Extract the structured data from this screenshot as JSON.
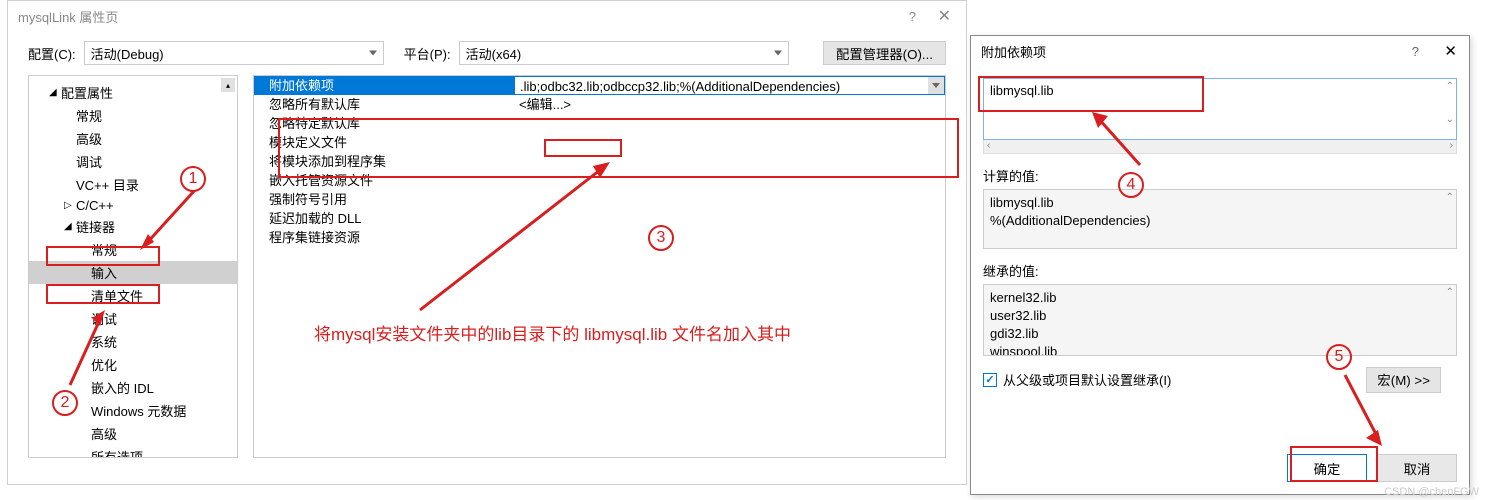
{
  "main": {
    "title": "mysqlLink 属性页",
    "help": "?",
    "close": "✕",
    "config_label": "配置(C):",
    "config_value": "活动(Debug)",
    "platform_label": "平台(P):",
    "platform_value": "活动(x64)",
    "config_mgr": "配置管理器(O)...",
    "tree": [
      {
        "label": "配置属性",
        "level": 0,
        "arrow": "◢"
      },
      {
        "label": "常规",
        "level": 1
      },
      {
        "label": "高级",
        "level": 1
      },
      {
        "label": "调试",
        "level": 1
      },
      {
        "label": "VC++ 目录",
        "level": 1
      },
      {
        "label": "C/C++",
        "level": 1,
        "arrow": "▷"
      },
      {
        "label": "链接器",
        "level": 1,
        "arrow": "◢"
      },
      {
        "label": "常规",
        "level": 2
      },
      {
        "label": "输入",
        "level": 2,
        "selected": true
      },
      {
        "label": "清单文件",
        "level": 2
      },
      {
        "label": "调试",
        "level": 2
      },
      {
        "label": "系统",
        "level": 2
      },
      {
        "label": "优化",
        "level": 2
      },
      {
        "label": "嵌入的 IDL",
        "level": 2
      },
      {
        "label": "Windows 元数据",
        "level": 2
      },
      {
        "label": "高级",
        "level": 2
      },
      {
        "label": "所有选项",
        "level": 2
      }
    ],
    "grid": [
      {
        "label": "附加依赖项",
        "value": ".lib;odbc32.lib;odbccp32.lib;%(AdditionalDependencies)",
        "selected": true,
        "dropdown": true
      },
      {
        "label": "忽略所有默认库",
        "value": "<编辑...>"
      },
      {
        "label": "忽略特定默认库",
        "value": ""
      },
      {
        "label": "模块定义文件",
        "value": ""
      },
      {
        "label": "将模块添加到程序集",
        "value": ""
      },
      {
        "label": "嵌入托管资源文件",
        "value": ""
      },
      {
        "label": "强制符号引用",
        "value": ""
      },
      {
        "label": "延迟加载的 DLL",
        "value": ""
      },
      {
        "label": "程序集链接资源",
        "value": ""
      }
    ],
    "annotation_text": "将mysql安装文件夹中的lib目录下的 libmysql.lib 文件名加入其中"
  },
  "secondary": {
    "title": "附加依赖项",
    "help": "?",
    "close": "✕",
    "input_value": "libmysql.lib",
    "calc_label": "计算的值:",
    "calc_lines": [
      "libmysql.lib",
      "%(AdditionalDependencies)"
    ],
    "inherit_label": "继承的值:",
    "inherit_lines": [
      "kernel32.lib",
      "user32.lib",
      "gdi32.lib",
      "winspool.lib"
    ],
    "checkbox_label": "从父级或项目默认设置继承(I)",
    "macro_btn": "宏(M) >>",
    "ok": "确定",
    "cancel": "取消"
  },
  "nums": {
    "n1": "1",
    "n2": "2",
    "n3": "3",
    "n4": "4",
    "n5": "5"
  },
  "watermark": "CSDN @chenFGW"
}
